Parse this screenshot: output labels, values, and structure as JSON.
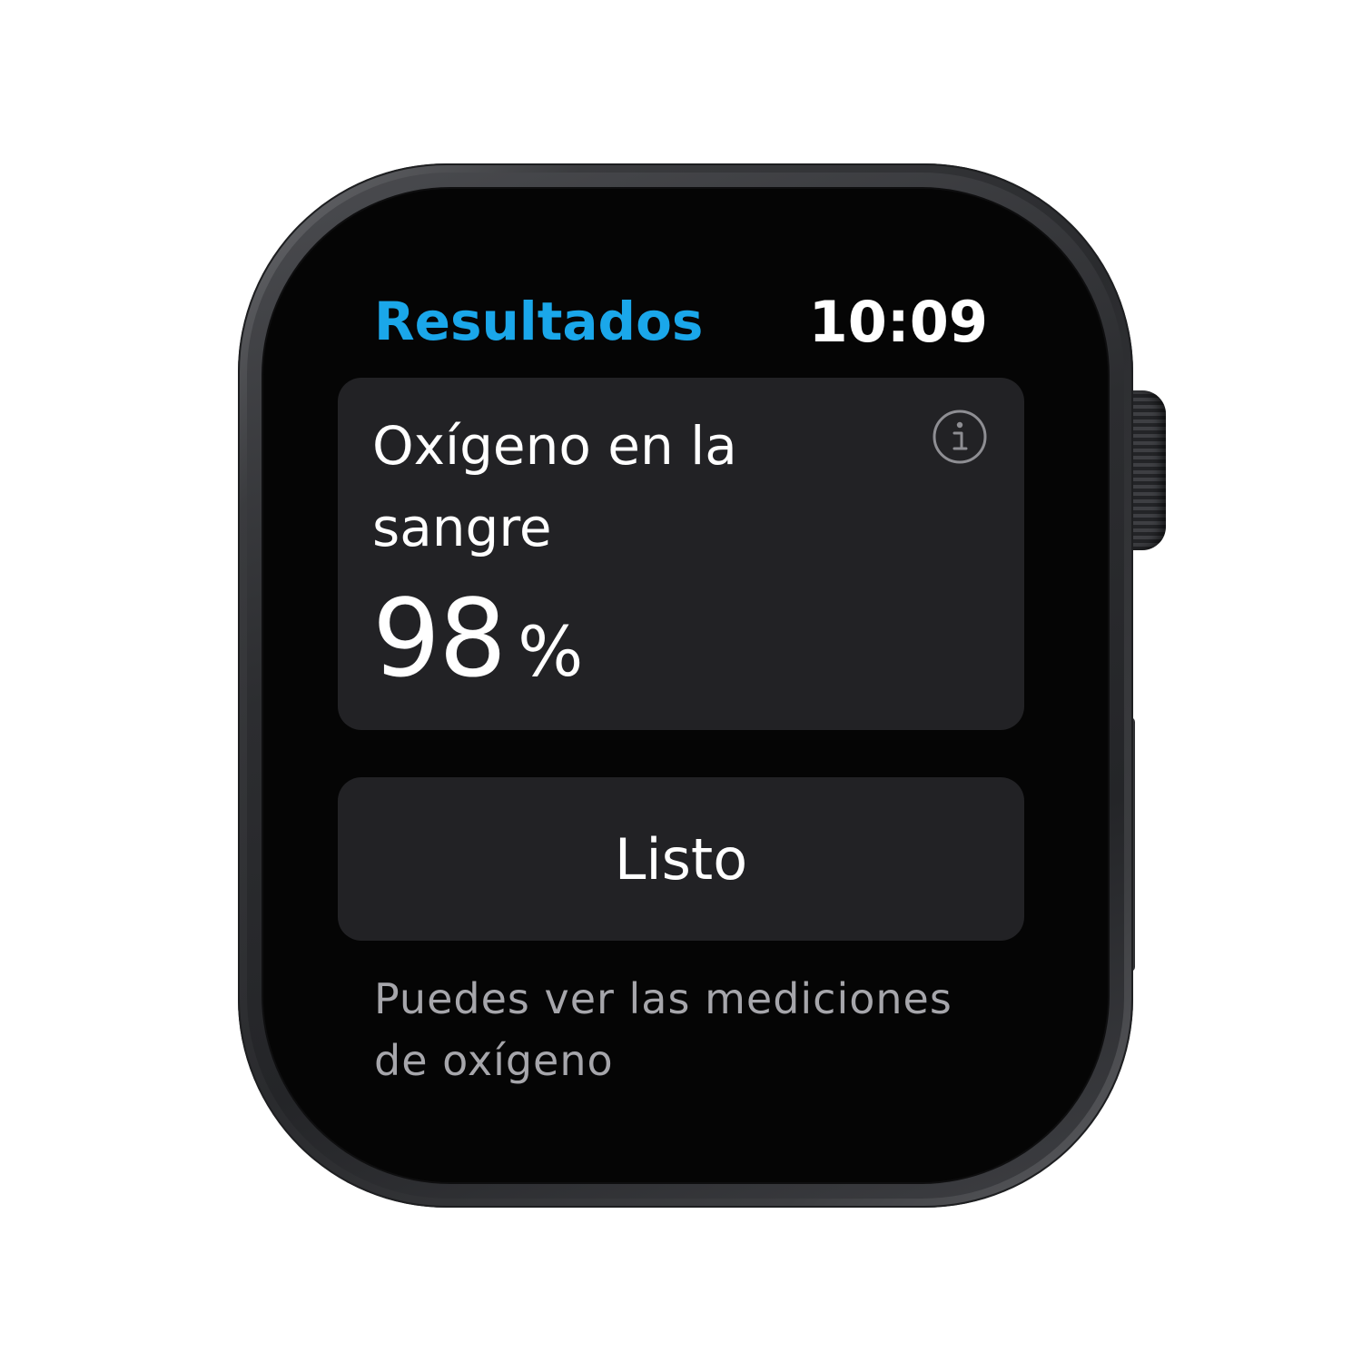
{
  "header": {
    "title": "Resultados",
    "time": "10:09"
  },
  "card": {
    "label": "Oxígeno en la sangre",
    "value": "98",
    "unit": "%",
    "icon": "info-icon"
  },
  "done_button": {
    "label": "Listo"
  },
  "footnote": {
    "text": "Puedes ver las mediciones de oxígeno"
  },
  "colors": {
    "accent": "#1aa7ea",
    "card_bg": "#222225",
    "screen_bg": "#050505",
    "secondary_text": "#a6a6ab"
  }
}
